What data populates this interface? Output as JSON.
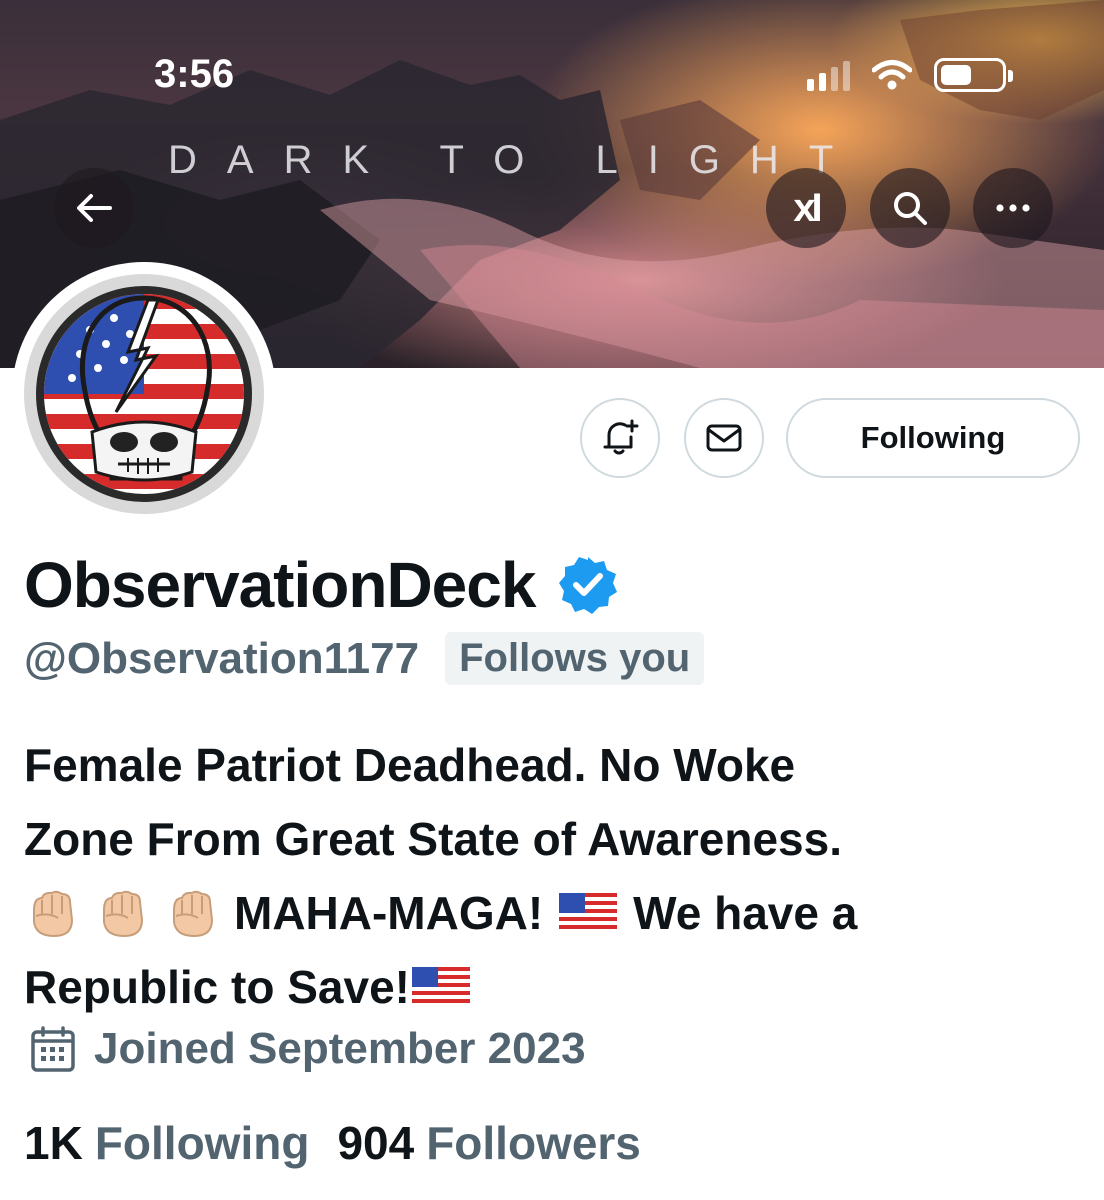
{
  "status_bar": {
    "time": "3:56"
  },
  "banner": {
    "title": "DARK TO LIGHT"
  },
  "banner_actions": {
    "grok_label": "xI"
  },
  "actions": {
    "following_label": "Following"
  },
  "profile": {
    "display_name": "ObservationDeck",
    "handle": "@Observation1177",
    "follows_you": "Follows you",
    "bio": {
      "line1": "Female Patriot Deadhead. No Woke",
      "line2": "Zone From Great State of Awareness.",
      "line3a": "MAHA-MAGA!",
      "line3b": "We have a",
      "line4": "Republic to Save!"
    },
    "joined": "Joined September 2023"
  },
  "stats": {
    "following_count": "1K",
    "following_label": "Following",
    "followers_count": "904",
    "followers_label": "Followers"
  },
  "icons": {
    "back": "arrow-left-icon",
    "search": "search-icon",
    "more": "more-icon",
    "bell": "notification-bell-icon",
    "mail": "envelope-icon",
    "verified": "verified-badge-icon",
    "calendar": "calendar-icon",
    "fist": "raised-fist-emoji",
    "flag": "us-flag-emoji"
  },
  "colors": {
    "verified": "#1d9bf0",
    "secondary_text": "#536471",
    "primary_text": "#0f1419"
  }
}
